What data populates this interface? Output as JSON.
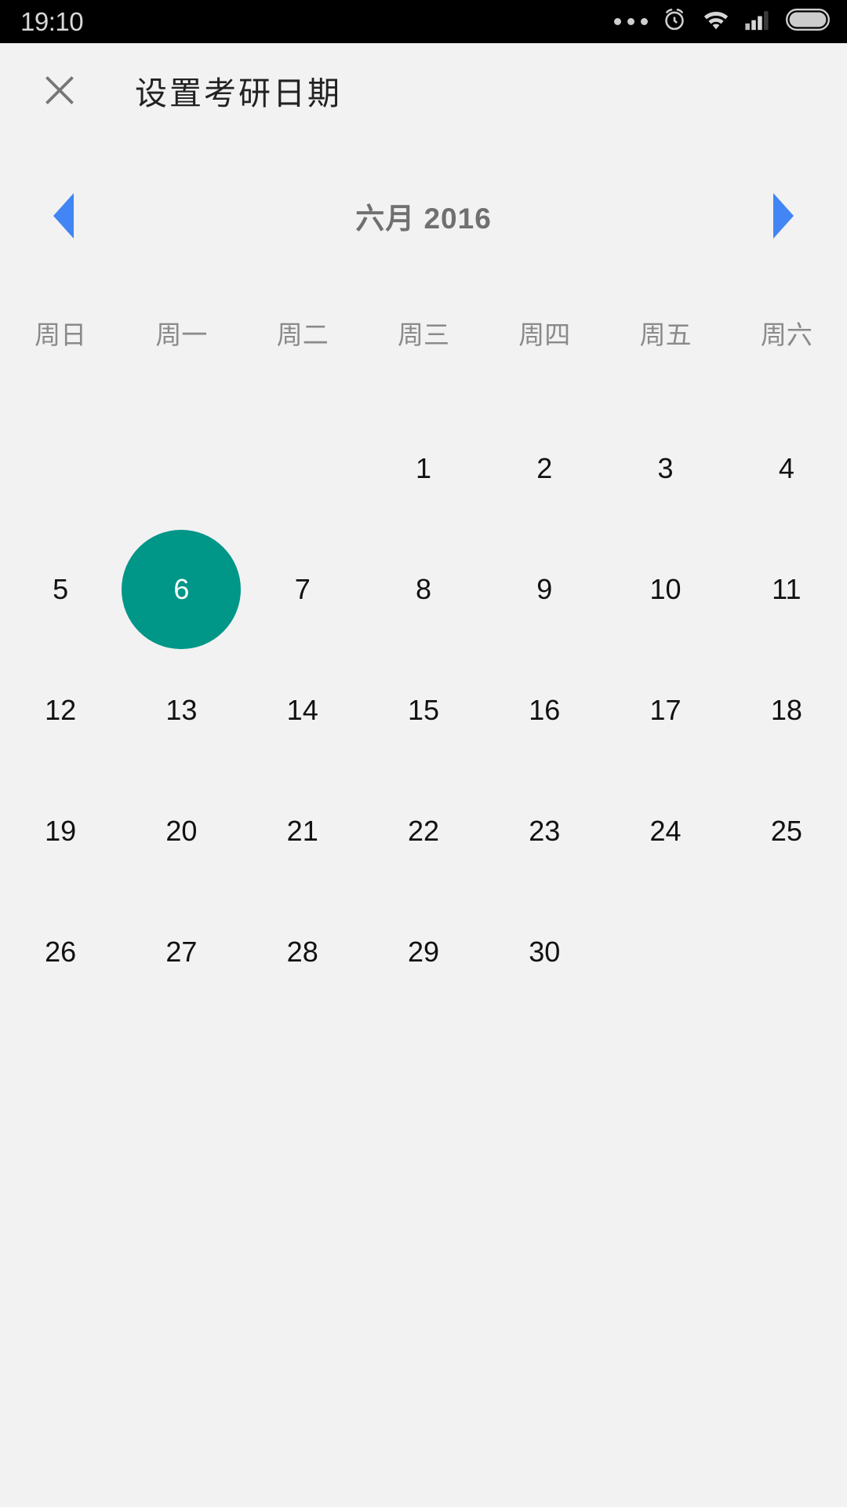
{
  "status_bar": {
    "time": "19:10",
    "icons": [
      "more-dots-icon",
      "alarm-clock-icon",
      "wifi-icon",
      "cellular-signal-icon",
      "battery-icon"
    ]
  },
  "header": {
    "close_label": "✕",
    "title": "设置考研日期"
  },
  "month_nav": {
    "prev_label": "prev-month",
    "next_label": "next-month",
    "month_year": "六月 2016",
    "month": "六月",
    "year": "2016"
  },
  "weekdays": [
    "周日",
    "周一",
    "周二",
    "周三",
    "周四",
    "周五",
    "周六"
  ],
  "calendar": {
    "leading_blanks": 3,
    "days": [
      {
        "n": "1"
      },
      {
        "n": "2"
      },
      {
        "n": "3"
      },
      {
        "n": "4"
      },
      {
        "n": "5"
      },
      {
        "n": "6",
        "selected": true
      },
      {
        "n": "7"
      },
      {
        "n": "8"
      },
      {
        "n": "9"
      },
      {
        "n": "10"
      },
      {
        "n": "11"
      },
      {
        "n": "12"
      },
      {
        "n": "13"
      },
      {
        "n": "14"
      },
      {
        "n": "15"
      },
      {
        "n": "16"
      },
      {
        "n": "17"
      },
      {
        "n": "18"
      },
      {
        "n": "19"
      },
      {
        "n": "20"
      },
      {
        "n": "21"
      },
      {
        "n": "22"
      },
      {
        "n": "23"
      },
      {
        "n": "24"
      },
      {
        "n": "25"
      },
      {
        "n": "26"
      },
      {
        "n": "27"
      },
      {
        "n": "28"
      },
      {
        "n": "29"
      },
      {
        "n": "30"
      }
    ],
    "selected_day": "6"
  },
  "colors": {
    "background": "#f2f2f2",
    "statusbar": "#000000",
    "accent_teal": "#009688",
    "arrow_blue": "#4285f4",
    "title_text": "#222222",
    "muted_text": "#8a8a8a"
  }
}
